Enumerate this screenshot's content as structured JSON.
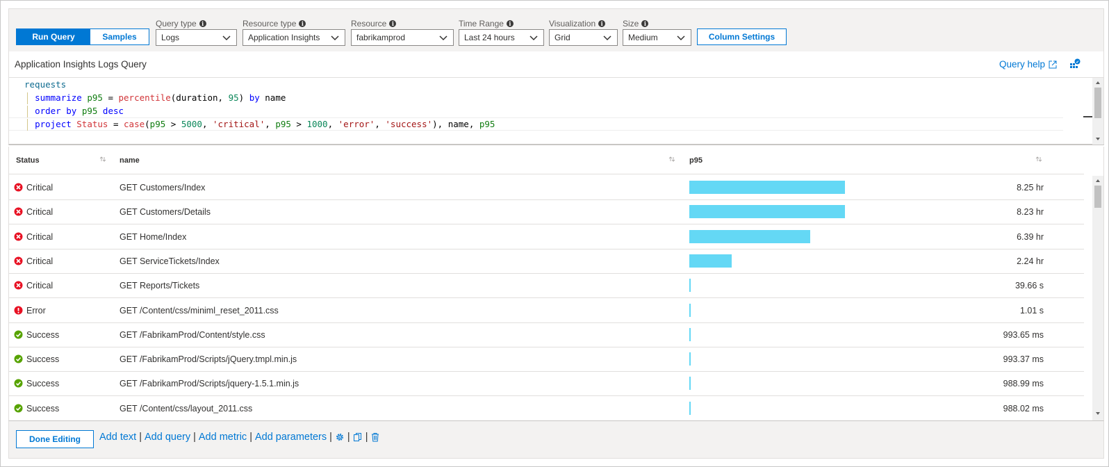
{
  "toolbar": {
    "run_query_label": "Run Query",
    "samples_label": "Samples",
    "query_type": {
      "label": "Query type",
      "value": "Logs"
    },
    "resource_type": {
      "label": "Resource type",
      "value": "Application Insights"
    },
    "resource": {
      "label": "Resource",
      "value": "fabrikamprod"
    },
    "time_range": {
      "label": "Time Range",
      "value": "Last 24 hours"
    },
    "visualization": {
      "label": "Visualization",
      "value": "Grid"
    },
    "size": {
      "label": "Size",
      "value": "Medium"
    },
    "column_settings_label": "Column Settings"
  },
  "query": {
    "title": "Application Insights Logs Query",
    "help_label": "Query help",
    "lines": [
      "requests",
      "| summarize p95 = percentile(duration, 95) by name",
      "| order by p95 desc",
      "| project Status = case(p95 > 5000, 'critical', p95 > 1000, 'error', 'success'), name, p95"
    ]
  },
  "grid": {
    "columns": [
      "Status",
      "name",
      "p95"
    ],
    "rows": [
      {
        "status": "Critical",
        "name": "GET Customers/Index",
        "value": "8.25 hr",
        "bar_fraction": 1.0
      },
      {
        "status": "Critical",
        "name": "GET Customers/Details",
        "value": "8.23 hr",
        "bar_fraction": 0.998
      },
      {
        "status": "Critical",
        "name": "GET Home/Index",
        "value": "6.39 hr",
        "bar_fraction": 0.775
      },
      {
        "status": "Critical",
        "name": "GET ServiceTickets/Index",
        "value": "2.24 hr",
        "bar_fraction": 0.272
      },
      {
        "status": "Critical",
        "name": "GET Reports/Tickets",
        "value": "39.66 s",
        "bar_fraction": 0.0013
      },
      {
        "status": "Error",
        "name": "GET /Content/css/miniml_reset_2011.css",
        "value": "1.01 s",
        "bar_fraction": 3e-05
      },
      {
        "status": "Success",
        "name": "GET /FabrikamProd/Content/style.css",
        "value": "993.65 ms",
        "bar_fraction": 3e-05
      },
      {
        "status": "Success",
        "name": "GET /FabrikamProd/Scripts/jQuery.tmpl.min.js",
        "value": "993.37 ms",
        "bar_fraction": 3e-05
      },
      {
        "status": "Success",
        "name": "GET /FabrikamProd/Scripts/jquery-1.5.1.min.js",
        "value": "988.99 ms",
        "bar_fraction": 3e-05
      },
      {
        "status": "Success",
        "name": "GET /Content/css/layout_2011.css",
        "value": "988.02 ms",
        "bar_fraction": 3e-05
      }
    ]
  },
  "footer": {
    "done_label": "Done Editing",
    "add_text": "Add text",
    "add_query": "Add query",
    "add_metric": "Add metric",
    "add_parameters": "Add parameters",
    "separator": "|"
  },
  "colors": {
    "accent": "#0078d4",
    "critical": "#e81123",
    "error": "#e81123",
    "success": "#57a300",
    "bar": "#64d8f5"
  },
  "icons": {
    "info": "info-icon",
    "chevron": "chevron-down-icon",
    "external": "external-link-icon",
    "pin": "pin-to-dashboard-icon",
    "sort": "sort-icon",
    "critical": "critical-x-icon",
    "error": "error-exclamation-icon",
    "success": "success-check-icon",
    "settings": "gear-icon",
    "clone": "clone-icon",
    "delete": "trash-icon"
  }
}
